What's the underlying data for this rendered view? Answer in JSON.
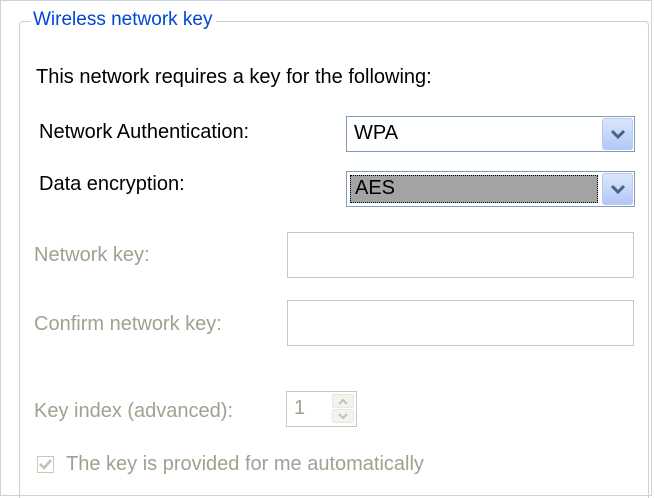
{
  "group": {
    "title": "Wireless network key"
  },
  "intro": {
    "text": "This network requires a key for the following:"
  },
  "authentication": {
    "label": "Network Authentication:",
    "value": "WPA",
    "dropdown_icon": "chevron-down-icon"
  },
  "encryption": {
    "label": "Data encryption:",
    "value": "AES",
    "dropdown_icon": "chevron-down-icon"
  },
  "network_key": {
    "label": "Network key:",
    "value": ""
  },
  "confirm_key": {
    "label": "Confirm network key:",
    "value": ""
  },
  "key_index": {
    "label": "Key index (advanced):",
    "value": "1",
    "up_icon": "spinner-up-icon",
    "down_icon": "spinner-down-icon"
  },
  "auto_key": {
    "label": "The key is provided for me automatically",
    "checked": true
  },
  "colors": {
    "legend_text": "#0046d5",
    "disabled_text": "#a1a192",
    "selection_highlight": "#a3a3a3",
    "combo_border": "#7f9db9"
  }
}
